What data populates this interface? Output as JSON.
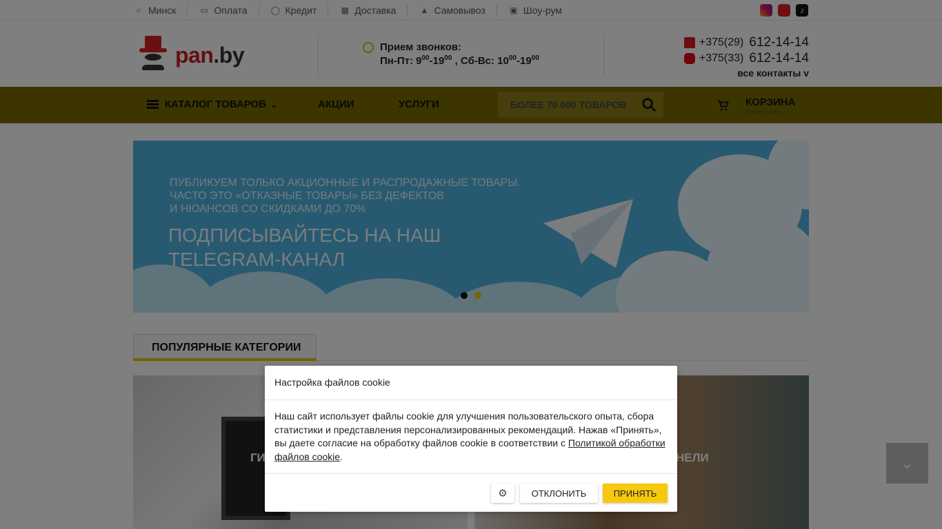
{
  "topbar": {
    "items": [
      {
        "label": "Минск",
        "icon": "location-icon"
      },
      {
        "label": "Оплата",
        "icon": "card-icon"
      },
      {
        "label": "Кредит",
        "icon": "credit-icon"
      },
      {
        "label": "Доставка",
        "icon": "truck-icon"
      },
      {
        "label": "Самовывоз",
        "icon": "car-icon"
      },
      {
        "label": "Шоу-рум",
        "icon": "picture-icon"
      }
    ],
    "social": [
      "instagram-icon",
      "youtube-icon",
      "tiktok-icon"
    ]
  },
  "header": {
    "logo_pan": "pan",
    "logo_by": ".by",
    "calls_title": "Прием звонков:",
    "calls_weekdays_label": "Пн-Пт:",
    "calls_weekdays_from": "9",
    "calls_weekdays_from_sup": "00",
    "calls_weekdays_to": "-19",
    "calls_weekdays_to_sup": "00",
    "calls_weekend_label": ", Сб-Вс:",
    "calls_weekend_from": "10",
    "calls_weekend_from_sup": "00",
    "calls_weekend_to": "-19",
    "calls_weekend_to_sup": "00",
    "phone1_code": "+375(29)",
    "phone1_number": "612-14-14",
    "phone2_code": "+375(33)",
    "phone2_number": "612-14-14",
    "contacts_link": "все контакты v"
  },
  "nav": {
    "catalog": "КАТАЛОГ ТОВАРОВ",
    "promo": "АКЦИИ",
    "services": "УСЛУГИ",
    "search_placeholder": "БОЛЕЕ 70 000 ТОВАРОВ",
    "cart_title": "КОРЗИНА",
    "cart_status": "Пока пуста"
  },
  "banner": {
    "line1": "ПУБЛИКУЕМ ТОЛЬКО АКЦИОННЫЕ И РАСПРОДАЖНЫЕ ТОВАРЫ.",
    "line2": "ЧАСТО ЭТО «ОТКАЗНЫЕ ТОВАРЫ» БЕЗ ДЕФЕКТОВ",
    "line3": "И НЮАНСОВ СО СКИДКАМИ ДО 70%",
    "headline1": "ПОДПИСЫВАЙТЕСЬ НА НАШ",
    "headline2": "TELEGRAM-КАНАЛ"
  },
  "popular": {
    "title": "ПОПУЛЯРНЫЕ КАТЕГОРИИ",
    "tile1_label": "ГИ",
    "tile2_label": "НЕЛИ"
  },
  "cookie": {
    "title": "Настройка файлов cookie",
    "body": "Наш сайт использует файлы cookie для улучшения пользовательского опыта, сбора статистики и представления персонализированных рекомендаций. Нажав «Принять», вы даете согласие на обработку файлов cookie в соответствии с ",
    "policy_link": "Политикой обработки файлов cookie",
    "body_end": ".",
    "decline": "ОТКЛОНИТЬ",
    "accept": "ПРИНЯТЬ"
  },
  "colors": {
    "accent_yellow": "#f6c90e",
    "brand_red": "#c62127",
    "banner_blue": "#4fb4e0"
  }
}
